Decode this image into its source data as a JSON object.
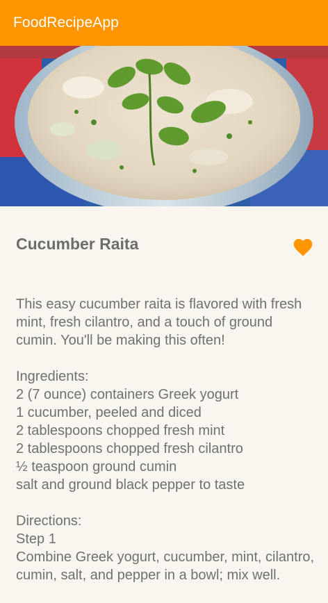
{
  "app": {
    "title": "FoodRecipeApp"
  },
  "recipe": {
    "title": "Cucumber Raita",
    "image_alt": "Cucumber raita in a glass bowl topped with mint and cilantro",
    "favorite": true,
    "description": "This easy cucumber raita is flavored with fresh mint, fresh cilantro, and a touch of ground cumin. You'll be making this often!\n\nIngredients:\n2 (7 ounce) containers Greek yogurt\n1 cucumber, peeled and diced\n2 tablespoons chopped fresh mint\n2 tablespoons chopped fresh cilantro\n½ teaspoon ground cumin\nsalt and ground black pepper to taste\n\nDirections:\nStep 1\nCombine Greek yogurt, cucumber, mint, cilantro, cumin, salt, and pepper in a bowl; mix well."
  },
  "colors": {
    "appbar": "#ff9500",
    "accent": "#ff9500",
    "background": "#f9f6ef"
  }
}
